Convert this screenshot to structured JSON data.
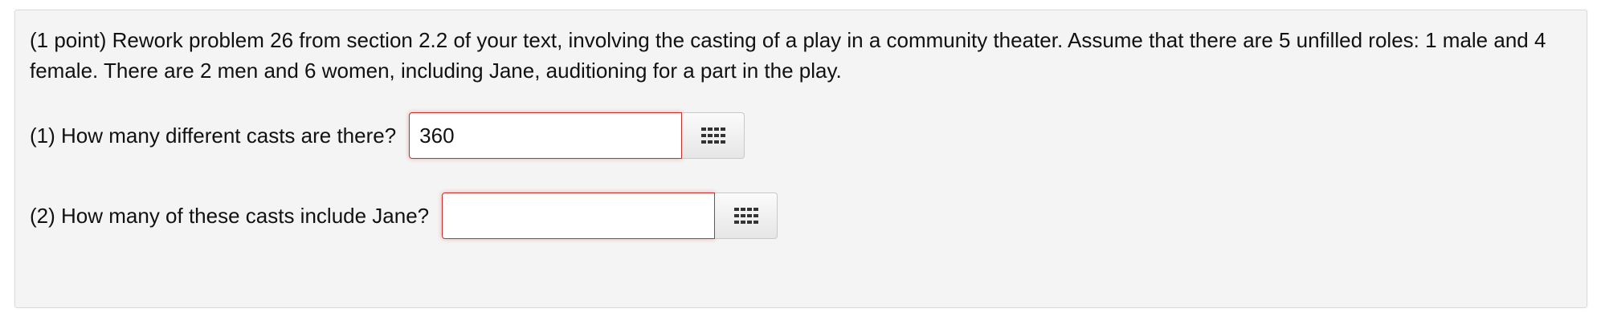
{
  "problem": {
    "text": "(1 point) Rework problem 26 from section 2.2 of your text, involving the casting of a play in a community theater. Assume that there are 5 unfilled roles: 1 male and 4 female. There are 2 men and 6 women, including Jane, auditioning for a part in the play."
  },
  "questions": [
    {
      "label": "(1) How many different casts are there?",
      "value": "360",
      "status": "incorrect",
      "button_icon": "keypad-grid-icon"
    },
    {
      "label": "(2) How many of these casts include Jane?",
      "value": "",
      "status": "incorrect",
      "button_icon": "keypad-grid-icon"
    }
  ],
  "colors": {
    "panel_background": "#f4f4f4",
    "error_border": "#c9302c"
  }
}
